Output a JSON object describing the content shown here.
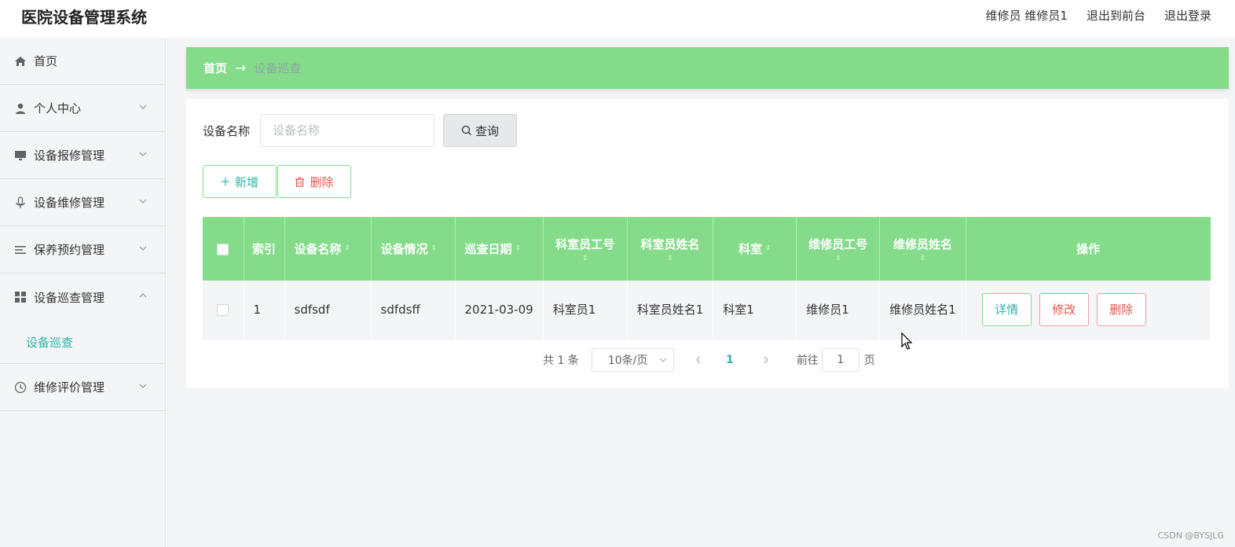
{
  "app": {
    "title": "医院设备管理系统",
    "user_role": "维修员",
    "user_name": "维修员1",
    "back_to_front": "退出到前台",
    "logout": "退出登录"
  },
  "sidebar": {
    "items": [
      {
        "label": "首页",
        "icon": "home-icon"
      },
      {
        "label": "个人中心",
        "icon": "user-icon"
      },
      {
        "label": "设备报修管理",
        "icon": "monitor-icon"
      },
      {
        "label": "设备维修管理",
        "icon": "microphone-icon"
      },
      {
        "label": "保养预约管理",
        "icon": "menu-lines-icon"
      },
      {
        "label": "设备巡查管理",
        "icon": "grid-icon",
        "expanded": true
      },
      {
        "label": "维修评价管理",
        "icon": "clock-icon"
      }
    ],
    "sub_active": "设备巡查"
  },
  "breadcrumb": {
    "home": "首页",
    "arrow": "→",
    "current": "设备巡查"
  },
  "search": {
    "label": "设备名称",
    "placeholder": "设备名称",
    "value": "",
    "button": "查询"
  },
  "actions": {
    "add": "新增",
    "delete": "删除"
  },
  "table": {
    "headers": [
      "索引",
      "设备名称",
      "设备情况",
      "巡查日期",
      "科室员工号",
      "科室员姓名",
      "科室",
      "维修员工号",
      "维修员姓名",
      "操作"
    ],
    "rows": [
      {
        "index": "1",
        "name": "sdfsdf",
        "condition": "sdfdsff",
        "date": "2021-03-09",
        "staff_id": "科室员1",
        "staff_name": "科室员姓名1",
        "dept": "科室1",
        "repair_id": "维修员1",
        "repair_name": "维修员姓名1"
      }
    ],
    "op_detail": "详情",
    "op_edit": "修改",
    "op_delete": "删除"
  },
  "pagination": {
    "total": "共 1 条",
    "page_size": "10条/页",
    "current": "1",
    "goto_label": "前往",
    "goto_value": "1",
    "goto_suffix": "页"
  },
  "watermark": "CSDN @BYSJLG",
  "colors": {
    "accent": "#84dc8a",
    "teal_text": "#2bb5a8",
    "danger": "#e3564a"
  }
}
